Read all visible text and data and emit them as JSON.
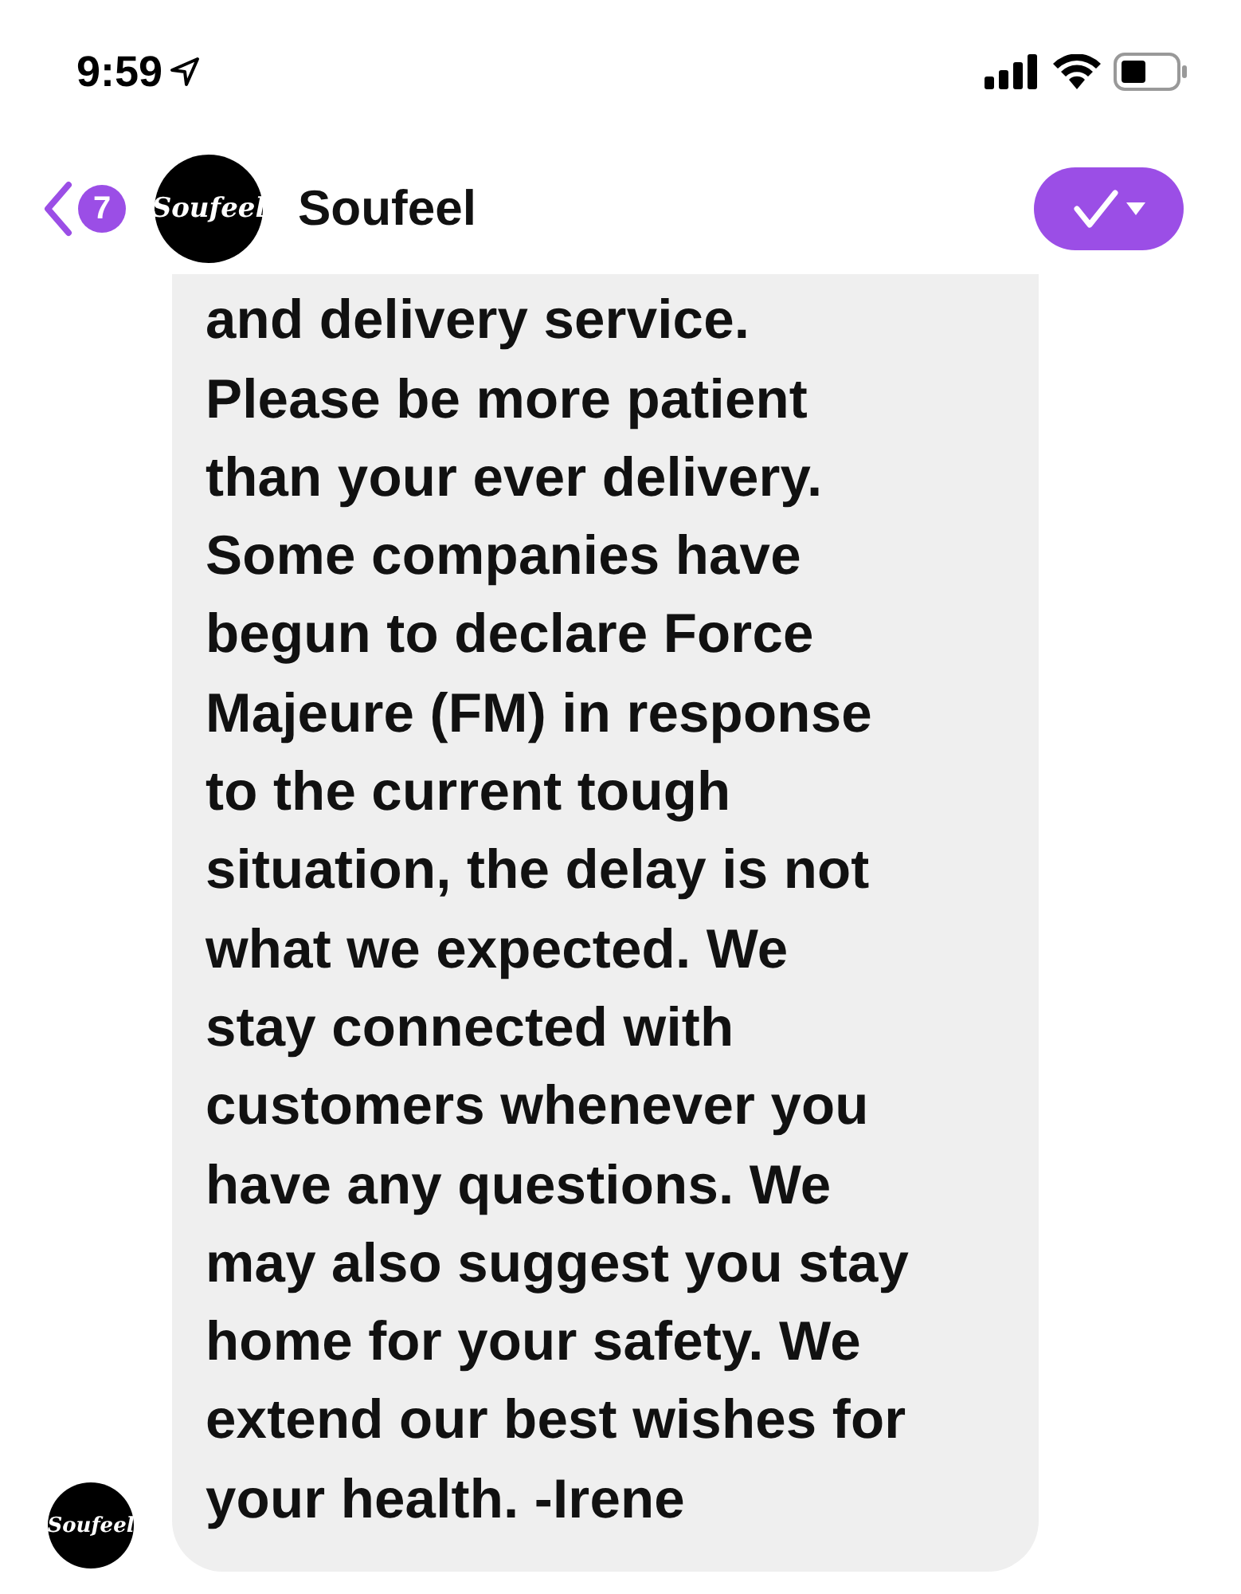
{
  "status_bar": {
    "time": "9:59"
  },
  "header": {
    "back_count": "7",
    "avatar_logo": "Soufeel",
    "name": "Soufeel"
  },
  "message": {
    "text": "and delivery service.\nPlease be more patient\nthan your ever delivery.\nSome companies have\nbegun to declare Force\nMajeure (FM) in response\nto the current tough\nsituation, the delay is not\nwhat we expected. We\nstay connected with\ncustomers whenever you\nhave any questions. We\nmay also suggest you stay\nhome for your safety. We\nextend our best wishes for\nyour health. -Irene",
    "sender_logo": "Soufeel"
  }
}
